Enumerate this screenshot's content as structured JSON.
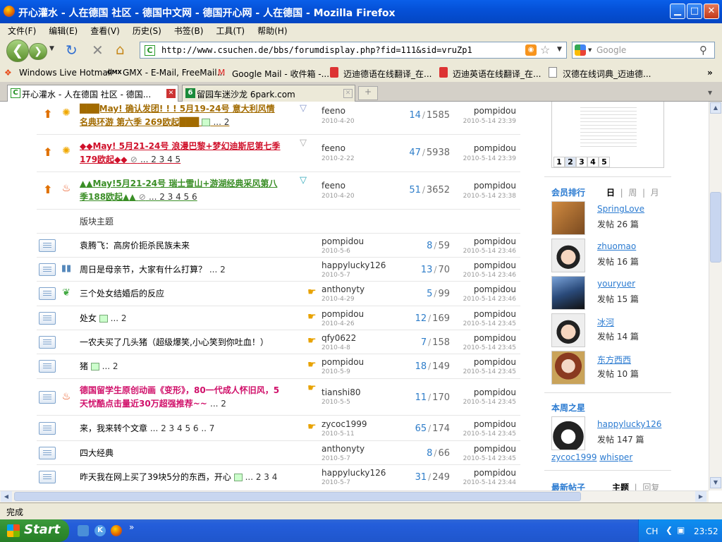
{
  "window": {
    "title": "开心灌水 - 人在德国 社区 - 德国中文网 - 德国开心网 - 人在德国 - Mozilla Firefox"
  },
  "menu": [
    "文件(F)",
    "编辑(E)",
    "查看(V)",
    "历史(S)",
    "书签(B)",
    "工具(T)",
    "帮助(H)"
  ],
  "address": {
    "url": "http://www.csuchen.de/bbs/forumdisplay.php?fid=111&sid=vruZp1",
    "search_placeholder": "Google"
  },
  "bookmarks": [
    "Windows Live Hotmail",
    "GMX - E-Mail, FreeMail...",
    "Google Mail - 收件箱 -...",
    "迈迪德语在线翻译_在...",
    "迈迪英语在线翻译_在...",
    "汉德在线词典_迈迪德..."
  ],
  "tabs": [
    {
      "label": "开心灌水 - 人在德国 社区 - 德国..."
    },
    {
      "label": "留园车迷沙龙 6park.com"
    }
  ],
  "sticky_threads": [
    {
      "title": "███May! 确认发团! ! ! 5月19-24号 意大利风情",
      "title2": "名典环游 第六季 269欧起███",
      "pages": "... 2",
      "author": "feeno",
      "date": "2010-4-20",
      "replies": "14",
      "views": "1585",
      "last_user": "pompidou",
      "last_time": "2010-5-14 23:39",
      "color": "#a26b00"
    },
    {
      "title": "◆◆May! 5月21-24号 浪漫巴黎+梦幻迪斯尼第七季",
      "title2": "179欧起◆◆",
      "pages": "... 2 3 4 5",
      "author": "feeno",
      "date": "2010-2-22",
      "replies": "47",
      "views": "5938",
      "last_user": "pompidou",
      "last_time": "2010-5-14 23:39",
      "color": "#d0102a"
    },
    {
      "title": "▲▲May!5月21-24号 瑞士雪山+游湖经典采风第八",
      "title2": "季188欧起▲▲",
      "pages": "... 2 3 4 5 6",
      "author": "feeno",
      "date": "2010-4-20",
      "replies": "51",
      "views": "3652",
      "last_user": "pompidou",
      "last_time": "2010-5-14 23:38",
      "color": "#3a8e26"
    }
  ],
  "section_label": "版块主题",
  "threads": [
    {
      "title": "袁腾飞：高房价扼杀民族未来",
      "pages": "",
      "author": "pompidou",
      "date": "2010-5-6",
      "replies": "8",
      "views": "59",
      "last_user": "pompidou",
      "last_time": "2010-5-14 23:46"
    },
    {
      "title": "周日是母亲节，大家有什么打算？",
      "pages": "... 2",
      "author": "happylucky126",
      "date": "2010-5-7",
      "replies": "13",
      "views": "70",
      "last_user": "pompidou",
      "last_time": "2010-5-14 23:46"
    },
    {
      "title": "三个处女结婚后的反应",
      "pages": "",
      "author": "anthonyty",
      "date": "2010-4-29",
      "replies": "5",
      "views": "99",
      "last_user": "pompidou",
      "last_time": "2010-5-14 23:46"
    },
    {
      "title": "处女",
      "pages": "... 2",
      "author": "pompidou",
      "date": "2010-4-26",
      "replies": "12",
      "views": "169",
      "last_user": "pompidou",
      "last_time": "2010-5-14 23:45"
    },
    {
      "title": "一农夫买了几头猪（超级爆笑,小心笑到你吐血！）",
      "pages": "",
      "author": "qfy0622",
      "date": "2010-4-8",
      "replies": "7",
      "views": "158",
      "last_user": "pompidou",
      "last_time": "2010-5-14 23:45"
    },
    {
      "title": "猪",
      "pages": "... 2",
      "author": "pompidou",
      "date": "2010-5-9",
      "replies": "18",
      "views": "149",
      "last_user": "pompidou",
      "last_time": "2010-5-14 23:45"
    },
    {
      "title": "德国留学生原创动画《变形》，80一代成人怀旧风，5",
      "title2": "天忧酷点击量近30万超强推荐~~",
      "pages": "... 2",
      "author": "tianshi80",
      "date": "2010-5-5",
      "replies": "11",
      "views": "170",
      "last_user": "pompidou",
      "last_time": "2010-5-14 23:45"
    },
    {
      "title": "来，我来转个文章",
      "pages": "... 2 3 4 5 6 .. 7",
      "author": "zycoc1999",
      "date": "2010-5-11",
      "replies": "65",
      "views": "174",
      "last_user": "pompidou",
      "last_time": "2010-5-14 23:45"
    },
    {
      "title": "四大经典",
      "pages": "",
      "author": "anthonyty",
      "date": "2010-5-7",
      "replies": "8",
      "views": "66",
      "last_user": "pompidou",
      "last_time": "2010-5-14 23:45"
    },
    {
      "title": "昨天我在网上买了39块5分的东西，开心",
      "pages": "... 2 3 4",
      "author": "happylucky126",
      "date": "2010-5-7",
      "replies": "31",
      "views": "249",
      "last_user": "pompidou",
      "last_time": "2010-5-14 23:44"
    }
  ],
  "sidebar": {
    "pager": [
      "1",
      "2",
      "3",
      "4",
      "5"
    ],
    "ranking_title": "会员排行",
    "ranking_tabs": [
      "日",
      "周",
      "月"
    ],
    "users": [
      {
        "name": "SpringLove",
        "posts": "发帖 26 篇"
      },
      {
        "name": "zhuomao",
        "posts": "发帖 16 篇"
      },
      {
        "name": "youryuer",
        "posts": "发帖 15 篇"
      },
      {
        "name": "冰河",
        "posts": "发帖 14 篇"
      },
      {
        "name": "东方西西",
        "posts": "发帖 10 篇"
      }
    ],
    "star_title": "本周之星",
    "star": {
      "name": "happylucky126",
      "posts": "发帖 147 篇"
    },
    "star_links": [
      "zycoc1999",
      "whisper"
    ],
    "latest_title": "最新帖子",
    "latest_tabs": [
      "主题",
      "回复"
    ]
  },
  "status": {
    "text": "完成"
  },
  "taskbar": {
    "start": "Start",
    "lang": "CH",
    "clock": "23:52"
  }
}
